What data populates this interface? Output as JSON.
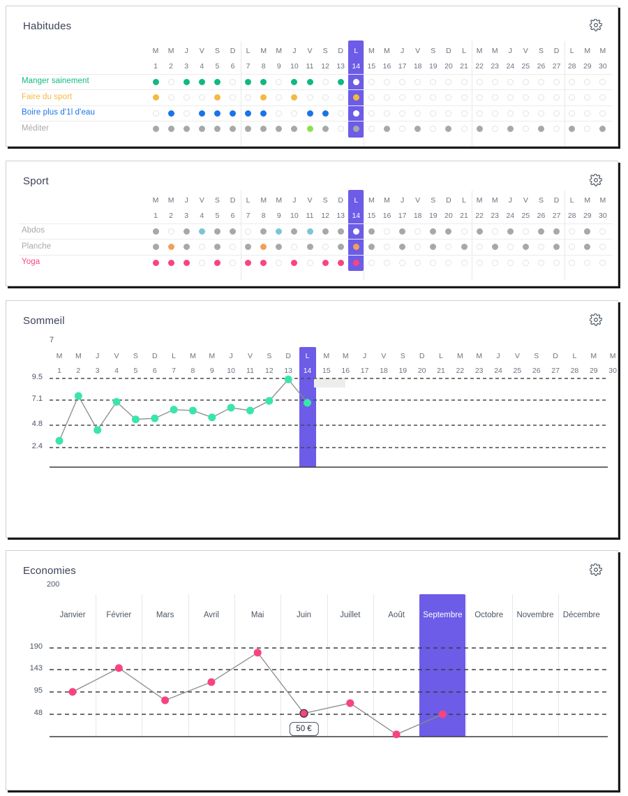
{
  "theme": {
    "highlight": "#6c5ce7",
    "card_border": "#cfcfcf",
    "card_shadow": "#1a1a1a",
    "text": "#3c4257",
    "muted": "#6b7280",
    "empty_dot": "#e2e2e2"
  },
  "cards": {
    "habitudes": {
      "title": "Habitudes",
      "gear_icon": "gear-icon",
      "dow": [
        "M",
        "M",
        "J",
        "V",
        "S",
        "D",
        "L",
        "M",
        "M",
        "J",
        "V",
        "S",
        "D",
        "L",
        "M",
        "M",
        "J",
        "V",
        "S",
        "D",
        "L",
        "M",
        "M",
        "J",
        "V",
        "S",
        "D",
        "L",
        "M",
        "M"
      ],
      "days": [
        "1",
        "2",
        "3",
        "4",
        "5",
        "6",
        "7",
        "8",
        "9",
        "10",
        "11",
        "12",
        "13",
        "14",
        "15",
        "16",
        "17",
        "18",
        "19",
        "20",
        "21",
        "22",
        "23",
        "24",
        "25",
        "26",
        "27",
        "28",
        "29",
        "30"
      ],
      "highlight_index": 13,
      "rows": [
        {
          "label": "Manger sainement",
          "color": "#10b981",
          "values": [
            1,
            0,
            1,
            1,
            1,
            0,
            1,
            1,
            0,
            1,
            1,
            0,
            1,
            1,
            0,
            0,
            0,
            0,
            0,
            0,
            0,
            0,
            0,
            0,
            0,
            0,
            0,
            0,
            0,
            0
          ]
        },
        {
          "label": "Faire du sport",
          "color": "#f5b941",
          "values": [
            1,
            0,
            0,
            0,
            1,
            0,
            0,
            1,
            0,
            1,
            0,
            0,
            0,
            1,
            0,
            0,
            0,
            0,
            0,
            0,
            0,
            0,
            0,
            0,
            0,
            0,
            0,
            0,
            0,
            0
          ]
        },
        {
          "label": "Boire plus d'1l d'eau",
          "color": "#1a73e8",
          "values": [
            0,
            1,
            0,
            1,
            1,
            1,
            1,
            1,
            0,
            0,
            1,
            1,
            0,
            1,
            0,
            0,
            0,
            0,
            0,
            0,
            0,
            0,
            0,
            0,
            0,
            0,
            0,
            0,
            0,
            0
          ]
        },
        {
          "label": "Méditer",
          "color": "#a8a8a8",
          "accent_color": "#8de04b",
          "accent_index": 10,
          "values": [
            1,
            1,
            1,
            1,
            1,
            1,
            1,
            1,
            1,
            1,
            1,
            1,
            0,
            1,
            0,
            1,
            0,
            1,
            0,
            1,
            0,
            1,
            0,
            1,
            0,
            1,
            0,
            1,
            0,
            1
          ]
        }
      ]
    },
    "sport": {
      "title": "Sport",
      "gear_icon": "gear-icon",
      "dow": [
        "M",
        "M",
        "J",
        "V",
        "S",
        "D",
        "L",
        "M",
        "M",
        "J",
        "V",
        "S",
        "D",
        "L",
        "M",
        "M",
        "J",
        "V",
        "S",
        "D",
        "L",
        "M",
        "M",
        "J",
        "V",
        "S",
        "D",
        "L",
        "M",
        "M"
      ],
      "days": [
        "1",
        "2",
        "3",
        "4",
        "5",
        "6",
        "7",
        "8",
        "9",
        "10",
        "11",
        "12",
        "13",
        "14",
        "15",
        "16",
        "17",
        "18",
        "19",
        "20",
        "21",
        "22",
        "23",
        "24",
        "25",
        "26",
        "27",
        "28",
        "29",
        "30"
      ],
      "highlight_index": 13,
      "rows": [
        {
          "label": "Abdos",
          "color": "#a8a8a8",
          "accent_color": "#7bc6d4",
          "values": [
            1,
            0,
            1,
            1,
            1,
            1,
            0,
            1,
            1,
            1,
            1,
            1,
            1,
            1,
            1,
            0,
            1,
            0,
            1,
            1,
            0,
            1,
            0,
            1,
            0,
            1,
            1,
            0,
            1,
            0
          ],
          "accent_indices": [
            3,
            8,
            10
          ]
        },
        {
          "label": "Planche",
          "color": "#a8a8a8",
          "accent_color": "#f1a05c",
          "values": [
            1,
            1,
            1,
            0,
            1,
            0,
            1,
            1,
            1,
            0,
            1,
            0,
            1,
            1,
            1,
            0,
            1,
            0,
            1,
            0,
            1,
            0,
            1,
            0,
            1,
            0,
            1,
            0,
            1,
            0
          ],
          "accent_indices": [
            1,
            7,
            13
          ]
        },
        {
          "label": "Yoga",
          "color": "#f9447e",
          "accent_color": "#f9447e",
          "values": [
            1,
            1,
            1,
            0,
            1,
            0,
            1,
            1,
            0,
            1,
            0,
            1,
            1,
            1,
            0,
            0,
            0,
            0,
            0,
            0,
            0,
            0,
            0,
            0,
            0,
            0,
            0,
            0,
            0,
            0
          ],
          "accent_indices": []
        }
      ]
    },
    "sommeil": {
      "title": "Sommeil",
      "gear_icon": "gear-icon"
    },
    "economies": {
      "title": "Economies",
      "gear_icon": "gear-icon",
      "tooltip": "50 €"
    }
  },
  "chart_data": [
    {
      "id": "sommeil",
      "type": "line",
      "title": "Sommeil",
      "axis_top_label": "7",
      "ylabel": "",
      "xlabel": "",
      "ytick_labels": [
        "9.5",
        "7.1",
        "4.8",
        "2.4"
      ],
      "ytick_values": [
        9.5,
        7.1,
        4.8,
        2.4
      ],
      "ylim": [
        0,
        10.6
      ],
      "grid": true,
      "legend": "none",
      "point_color": "#3ae5ac",
      "line_color": "#8a8a8a",
      "highlight_index": 13,
      "x_dow": [
        "M",
        "M",
        "J",
        "V",
        "S",
        "D",
        "L",
        "M",
        "M",
        "J",
        "V",
        "S",
        "D",
        "L",
        "M",
        "M",
        "J",
        "V",
        "S",
        "D",
        "L",
        "M",
        "M",
        "J",
        "V",
        "S",
        "D",
        "L",
        "M",
        "M"
      ],
      "x": [
        "1",
        "2",
        "3",
        "4",
        "5",
        "6",
        "7",
        "8",
        "9",
        "10",
        "11",
        "12",
        "13",
        "14",
        "15",
        "16",
        "17",
        "18",
        "19",
        "20",
        "21",
        "22",
        "23",
        "24",
        "25",
        "26",
        "27",
        "28",
        "29",
        "30"
      ],
      "values": [
        3.1,
        7.7,
        4.2,
        7.1,
        5.3,
        5.4,
        6.3,
        6.2,
        5.5,
        6.5,
        6.2,
        7.2,
        9.4,
        7.0,
        null,
        null,
        null,
        null,
        null,
        null,
        null,
        null,
        null,
        null,
        null,
        null,
        null,
        null,
        null,
        null
      ]
    },
    {
      "id": "economies",
      "type": "line",
      "title": "Economies",
      "axis_top_label": "200",
      "ylabel": "",
      "xlabel": "",
      "ytick_labels": [
        "190",
        "143",
        "95",
        "48"
      ],
      "ytick_values": [
        190,
        143,
        95,
        48
      ],
      "ylim": [
        0,
        200
      ],
      "grid": true,
      "legend": "none",
      "point_color": "#f9447e",
      "line_color": "#8a8a8a",
      "highlight_index": 8,
      "highlight_label": "Septembre",
      "tooltip": {
        "label": "50 €",
        "index": 5
      },
      "categories": [
        "Janvier",
        "Février",
        "Mars",
        "Avril",
        "Mai",
        "Juin",
        "Juillet",
        "Août",
        "Septembre",
        "Octobre",
        "Novembre",
        "Décembre"
      ],
      "values": [
        96,
        147,
        78,
        117,
        180,
        50,
        72,
        5,
        48,
        null,
        null,
        null
      ]
    }
  ]
}
